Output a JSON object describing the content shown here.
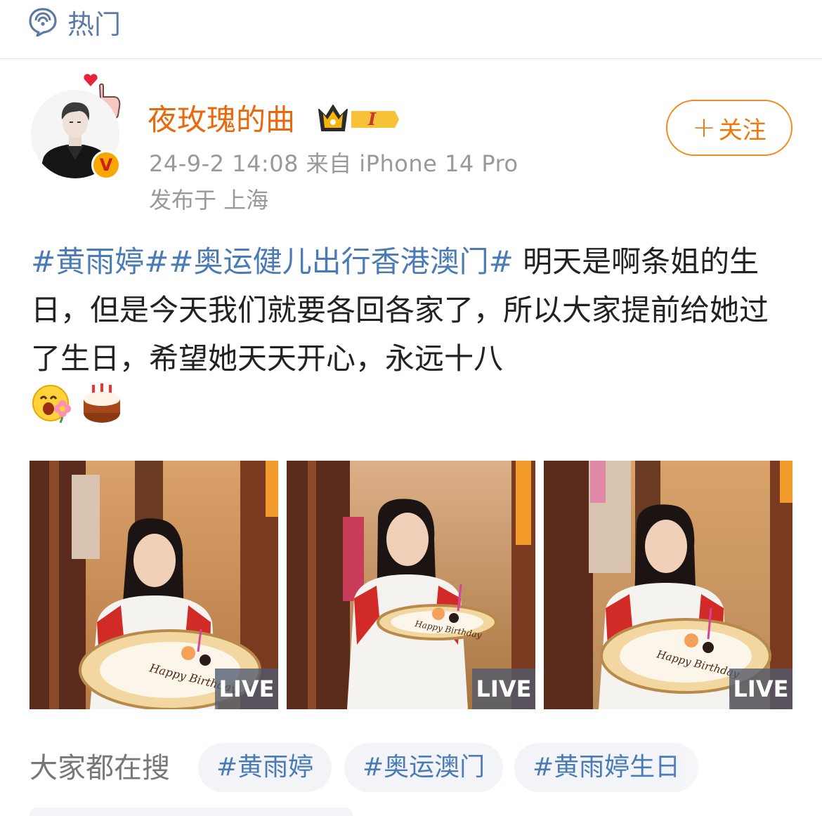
{
  "header": {
    "section_title": "热门"
  },
  "post": {
    "author": {
      "name": "夜玫瑰的曲",
      "verified_badge": "V",
      "member_level": "I"
    },
    "meta": {
      "time_source": "24-9-2 14:08  来自 iPhone 14 Pro",
      "location": "发布于 上海"
    },
    "follow_label": "关注",
    "follow_plus": "+",
    "text": {
      "tag1": "#黄雨婷#",
      "tag2": "#奥运健儿出行香港澳门#",
      "body": " 明天是啊条姐的生日，但是今天我们就要各回各家了，所以大家提前给她过了生日，希望她天天开心，永远十八"
    },
    "emojis": [
      "happy-flower-emoji",
      "birthday-cake-emoji"
    ],
    "photos": [
      {
        "badge": "LIVE"
      },
      {
        "badge": "LIVE"
      },
      {
        "badge": "LIVE"
      }
    ],
    "plate_text": "Happy Birthday"
  },
  "trending": {
    "label": "大家都在搜",
    "chips": [
      "#黄雨婷",
      "#奥运澳门",
      "#黄雨婷生日"
    ]
  },
  "colors": {
    "link_blue": "#4b7bb7",
    "username_orange": "#e8680b",
    "follow_orange": "#f38a1e",
    "meta_gray": "#999999"
  }
}
